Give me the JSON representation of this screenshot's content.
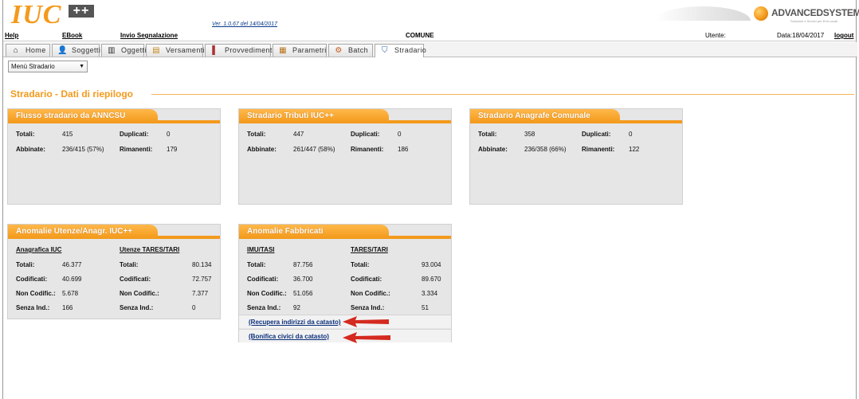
{
  "header": {
    "logo_text": "IUC",
    "logo_plus": "++",
    "version": "Ver. 1.0.67 del 14/04/2017",
    "brand_name": "ADVANCEDSYSTEMS",
    "brand_sub": "Soluzioni e Servizi per Enti Locali"
  },
  "menubar": {
    "help": "Help",
    "ebook": "EBook",
    "invio": "Invio Segnalazione",
    "comune": "COMUNE",
    "utente": "Utente:",
    "data": "Data:18/04/2017",
    "logout": "logout"
  },
  "tabs": [
    {
      "label": "Home",
      "icon": "home-icon"
    },
    {
      "label": "Soggetti",
      "icon": "person-icon"
    },
    {
      "label": "Oggetti",
      "icon": "building-icon"
    },
    {
      "label": "Versamenti",
      "icon": "money-icon"
    },
    {
      "label": "Provvedimenti",
      "icon": "document-icon"
    },
    {
      "label": "Parametri",
      "icon": "table-icon"
    },
    {
      "label": "Batch",
      "icon": "batch-icon"
    },
    {
      "label": "Stradario",
      "icon": "road-icon"
    }
  ],
  "select": {
    "value": "Menù Stradario"
  },
  "page_title": "Stradario - Dati di riepilogo",
  "panels": {
    "p1": {
      "title": "Flusso stradario da ANNCSU",
      "totali_l": "Totali:",
      "totali": "415",
      "dup_l": "Duplicati:",
      "dup": "0",
      "abb_l": "Abbinate:",
      "abb": "236/415 (57%)",
      "rim_l": "Rimanenti:",
      "rim": "179"
    },
    "p2": {
      "title": "Stradario Tributi IUC++",
      "totali_l": "Totali:",
      "totali": "447",
      "dup_l": "Duplicati:",
      "dup": "0",
      "abb_l": "Abbinate:",
      "abb": "261/447 (58%)",
      "rim_l": "Rimanenti:",
      "rim": "186"
    },
    "p3": {
      "title": "Stradario Anagrafe Comunale",
      "totali_l": "Totali:",
      "totali": "358",
      "dup_l": "Duplicati:",
      "dup": "0",
      "abb_l": "Abbinate:",
      "abb": "236/358 (66%)",
      "rim_l": "Rimanenti:",
      "rim": "122"
    },
    "p4": {
      "title": "Anomalie Utenze/Anagr. IUC++",
      "col1": "Anagrafica IUC",
      "col2": "Utenze TARES/TARI",
      "rows": [
        {
          "l": "Totali:",
          "a": "46.377",
          "b": "80.134"
        },
        {
          "l": "Codificati:",
          "a": "40.699",
          "b": "72.757"
        },
        {
          "l": "Non Codific.:",
          "a": "5.678",
          "b": "7.377"
        },
        {
          "l": "Senza Ind.:",
          "a": "166",
          "b": "0"
        }
      ]
    },
    "p5": {
      "title": "Anomalie Fabbricati",
      "col1": "IMU/TASI",
      "col2": "TARES/TARI",
      "rows": [
        {
          "l": "Totali:",
          "a": "87.756",
          "b": "93.004"
        },
        {
          "l": "Codificati:",
          "a": "36.700",
          "b": "89.670"
        },
        {
          "l": "Non Codific.:",
          "a": "51.056",
          "b": "3.334"
        },
        {
          "l": "Senza Ind.:",
          "a": "92",
          "b": "51"
        }
      ],
      "link1": "(Recupera indirizzi da catasto)",
      "link2": "(Bonifica civici da catasto)"
    }
  },
  "colors": {
    "accent": "#f39a1c",
    "arrow": "#d42a1f"
  }
}
